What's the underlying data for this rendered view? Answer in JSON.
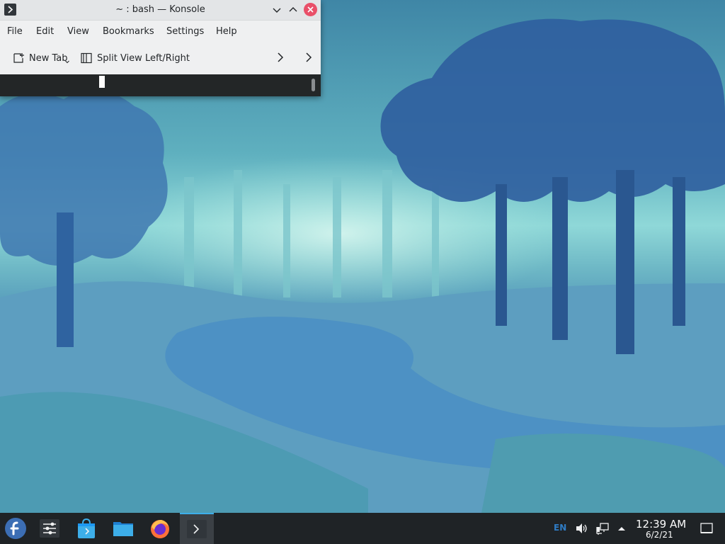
{
  "window": {
    "title": "~ : bash — Konsole",
    "menu": [
      "File",
      "Edit",
      "View",
      "Bookmarks",
      "Settings",
      "Help"
    ],
    "toolbar": {
      "new_tab": "New Tab",
      "split_view": "Split View Left/Right"
    }
  },
  "taskbar": {
    "launchers": [
      {
        "name": "Fedora Application Launcher",
        "icon": "fedora-icon"
      },
      {
        "name": "System Settings",
        "icon": "settings-sliders-icon"
      },
      {
        "name": "Discover",
        "icon": "store-bag-icon"
      },
      {
        "name": "Dolphin",
        "icon": "folder-icon"
      },
      {
        "name": "Firefox",
        "icon": "firefox-icon"
      },
      {
        "name": "Konsole",
        "icon": "terminal-icon"
      }
    ],
    "tray": {
      "language": "EN",
      "time": "12:39 AM",
      "date": "6/2/21"
    }
  }
}
